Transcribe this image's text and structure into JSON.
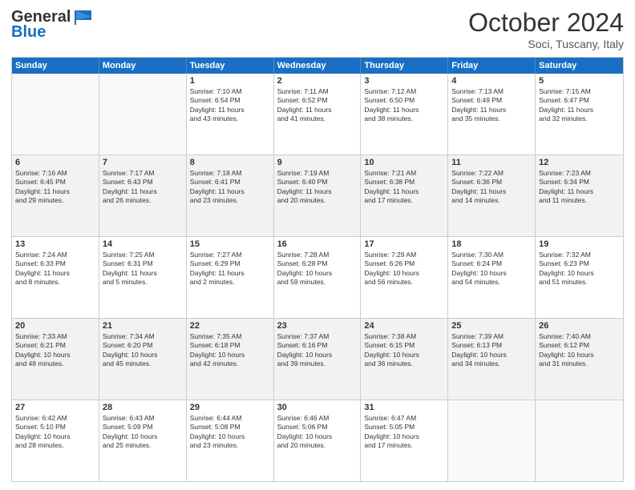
{
  "header": {
    "logo_line1": "General",
    "logo_line2": "Blue",
    "month": "October 2024",
    "location": "Soci, Tuscany, Italy"
  },
  "days_of_week": [
    "Sunday",
    "Monday",
    "Tuesday",
    "Wednesday",
    "Thursday",
    "Friday",
    "Saturday"
  ],
  "rows": [
    [
      {
        "day": "",
        "lines": [],
        "empty": true
      },
      {
        "day": "",
        "lines": [],
        "empty": true
      },
      {
        "day": "1",
        "lines": [
          "Sunrise: 7:10 AM",
          "Sunset: 6:54 PM",
          "Daylight: 11 hours",
          "and 43 minutes."
        ]
      },
      {
        "day": "2",
        "lines": [
          "Sunrise: 7:11 AM",
          "Sunset: 6:52 PM",
          "Daylight: 11 hours",
          "and 41 minutes."
        ]
      },
      {
        "day": "3",
        "lines": [
          "Sunrise: 7:12 AM",
          "Sunset: 6:50 PM",
          "Daylight: 11 hours",
          "and 38 minutes."
        ]
      },
      {
        "day": "4",
        "lines": [
          "Sunrise: 7:13 AM",
          "Sunset: 6:49 PM",
          "Daylight: 11 hours",
          "and 35 minutes."
        ]
      },
      {
        "day": "5",
        "lines": [
          "Sunrise: 7:15 AM",
          "Sunset: 6:47 PM",
          "Daylight: 11 hours",
          "and 32 minutes."
        ]
      }
    ],
    [
      {
        "day": "6",
        "lines": [
          "Sunrise: 7:16 AM",
          "Sunset: 6:45 PM",
          "Daylight: 11 hours",
          "and 29 minutes."
        ]
      },
      {
        "day": "7",
        "lines": [
          "Sunrise: 7:17 AM",
          "Sunset: 6:43 PM",
          "Daylight: 11 hours",
          "and 26 minutes."
        ]
      },
      {
        "day": "8",
        "lines": [
          "Sunrise: 7:18 AM",
          "Sunset: 6:41 PM",
          "Daylight: 11 hours",
          "and 23 minutes."
        ]
      },
      {
        "day": "9",
        "lines": [
          "Sunrise: 7:19 AM",
          "Sunset: 6:40 PM",
          "Daylight: 11 hours",
          "and 20 minutes."
        ]
      },
      {
        "day": "10",
        "lines": [
          "Sunrise: 7:21 AM",
          "Sunset: 6:38 PM",
          "Daylight: 11 hours",
          "and 17 minutes."
        ]
      },
      {
        "day": "11",
        "lines": [
          "Sunrise: 7:22 AM",
          "Sunset: 6:36 PM",
          "Daylight: 11 hours",
          "and 14 minutes."
        ]
      },
      {
        "day": "12",
        "lines": [
          "Sunrise: 7:23 AM",
          "Sunset: 6:34 PM",
          "Daylight: 11 hours",
          "and 11 minutes."
        ]
      }
    ],
    [
      {
        "day": "13",
        "lines": [
          "Sunrise: 7:24 AM",
          "Sunset: 6:33 PM",
          "Daylight: 11 hours",
          "and 8 minutes."
        ]
      },
      {
        "day": "14",
        "lines": [
          "Sunrise: 7:25 AM",
          "Sunset: 6:31 PM",
          "Daylight: 11 hours",
          "and 5 minutes."
        ]
      },
      {
        "day": "15",
        "lines": [
          "Sunrise: 7:27 AM",
          "Sunset: 6:29 PM",
          "Daylight: 11 hours",
          "and 2 minutes."
        ]
      },
      {
        "day": "16",
        "lines": [
          "Sunrise: 7:28 AM",
          "Sunset: 6:28 PM",
          "Daylight: 10 hours",
          "and 59 minutes."
        ]
      },
      {
        "day": "17",
        "lines": [
          "Sunrise: 7:29 AM",
          "Sunset: 6:26 PM",
          "Daylight: 10 hours",
          "and 56 minutes."
        ]
      },
      {
        "day": "18",
        "lines": [
          "Sunrise: 7:30 AM",
          "Sunset: 6:24 PM",
          "Daylight: 10 hours",
          "and 54 minutes."
        ]
      },
      {
        "day": "19",
        "lines": [
          "Sunrise: 7:32 AM",
          "Sunset: 6:23 PM",
          "Daylight: 10 hours",
          "and 51 minutes."
        ]
      }
    ],
    [
      {
        "day": "20",
        "lines": [
          "Sunrise: 7:33 AM",
          "Sunset: 6:21 PM",
          "Daylight: 10 hours",
          "and 48 minutes."
        ]
      },
      {
        "day": "21",
        "lines": [
          "Sunrise: 7:34 AM",
          "Sunset: 6:20 PM",
          "Daylight: 10 hours",
          "and 45 minutes."
        ]
      },
      {
        "day": "22",
        "lines": [
          "Sunrise: 7:35 AM",
          "Sunset: 6:18 PM",
          "Daylight: 10 hours",
          "and 42 minutes."
        ]
      },
      {
        "day": "23",
        "lines": [
          "Sunrise: 7:37 AM",
          "Sunset: 6:16 PM",
          "Daylight: 10 hours",
          "and 39 minutes."
        ]
      },
      {
        "day": "24",
        "lines": [
          "Sunrise: 7:38 AM",
          "Sunset: 6:15 PM",
          "Daylight: 10 hours",
          "and 36 minutes."
        ]
      },
      {
        "day": "25",
        "lines": [
          "Sunrise: 7:39 AM",
          "Sunset: 6:13 PM",
          "Daylight: 10 hours",
          "and 34 minutes."
        ]
      },
      {
        "day": "26",
        "lines": [
          "Sunrise: 7:40 AM",
          "Sunset: 6:12 PM",
          "Daylight: 10 hours",
          "and 31 minutes."
        ]
      }
    ],
    [
      {
        "day": "27",
        "lines": [
          "Sunrise: 6:42 AM",
          "Sunset: 5:10 PM",
          "Daylight: 10 hours",
          "and 28 minutes."
        ]
      },
      {
        "day": "28",
        "lines": [
          "Sunrise: 6:43 AM",
          "Sunset: 5:09 PM",
          "Daylight: 10 hours",
          "and 25 minutes."
        ]
      },
      {
        "day": "29",
        "lines": [
          "Sunrise: 6:44 AM",
          "Sunset: 5:08 PM",
          "Daylight: 10 hours",
          "and 23 minutes."
        ]
      },
      {
        "day": "30",
        "lines": [
          "Sunrise: 6:46 AM",
          "Sunset: 5:06 PM",
          "Daylight: 10 hours",
          "and 20 minutes."
        ]
      },
      {
        "day": "31",
        "lines": [
          "Sunrise: 6:47 AM",
          "Sunset: 5:05 PM",
          "Daylight: 10 hours",
          "and 17 minutes."
        ]
      },
      {
        "day": "",
        "lines": [],
        "empty": true
      },
      {
        "day": "",
        "lines": [],
        "empty": true
      }
    ]
  ]
}
